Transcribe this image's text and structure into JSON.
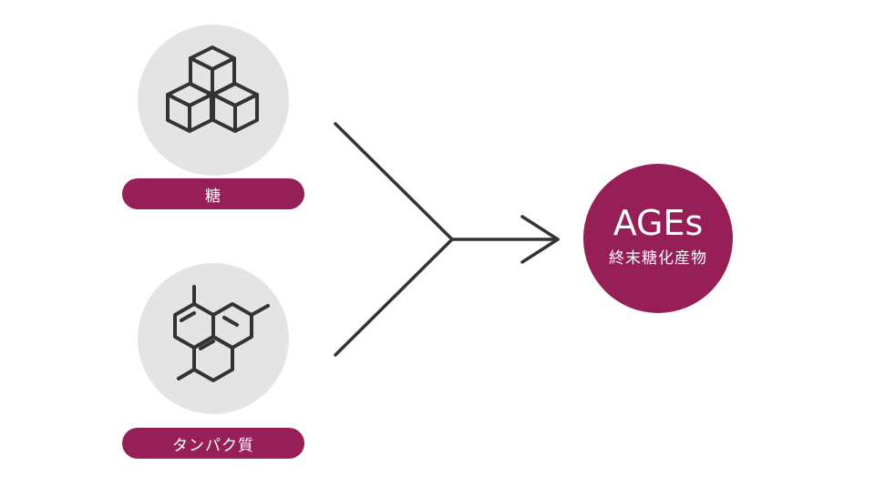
{
  "inputs": {
    "sugar": {
      "label": "糖",
      "icon": "sugar-cubes-icon"
    },
    "protein": {
      "label": "タンパク質",
      "icon": "molecule-structure-icon"
    }
  },
  "result": {
    "title": "AGEs",
    "subtitle": "終末糖化産物"
  },
  "colors": {
    "accent": "#951f56",
    "icon_background": "#e4e4e4",
    "line": "#333333"
  }
}
